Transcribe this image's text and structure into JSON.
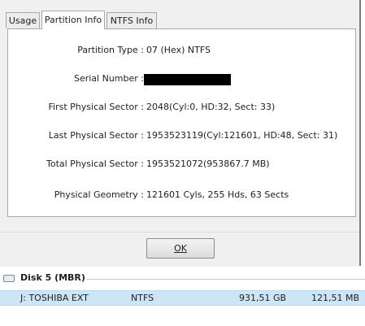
{
  "tabs": [
    "Usage",
    "Partition Info",
    "NTFS Info"
  ],
  "active_tab": "Partition Info",
  "info": [
    {
      "label": "Partition Type :",
      "value": "07 (Hex) NTFS"
    },
    {
      "label": "Serial Number :",
      "value": ""
    },
    {
      "label": "First Physical Sector :",
      "value": "2048(Cyl:0, HD:32, Sect: 33)"
    },
    {
      "label": "Last Physical Sector :",
      "value": "1953523119(Cyl:121601, HD:48, Sect: 31)"
    },
    {
      "label": "Total Physical Sector :",
      "value": "1953521072(953867.7 MB)"
    },
    {
      "label": "Physical Geometry :",
      "value": "121601 Cyls, 255 Hds, 63 Sects"
    }
  ],
  "ok_label": "OK",
  "disk": {
    "title": "Disk 5 (MBR)",
    "partition": {
      "name": "J: TOSHIBA EXT",
      "fs": "NTFS",
      "capacity": "931,51 GB",
      "used": "121,51 MB"
    }
  },
  "colors": {
    "selected_row": "#cde6f7",
    "dialog_bg": "#f0f0f0"
  },
  "icons": {
    "disk": "drive-icon"
  }
}
